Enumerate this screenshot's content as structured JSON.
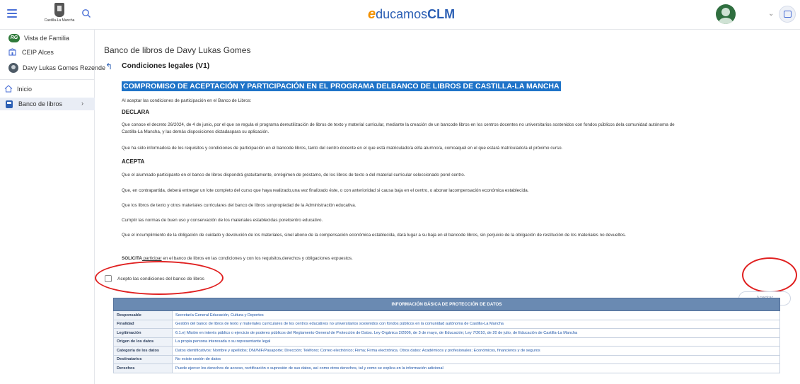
{
  "header": {
    "crest_text": "Castilla-La Mancha",
    "logo": {
      "e": "e",
      "ducamos": "ducamos",
      "clm": "CLM"
    }
  },
  "sidebar": {
    "family_badge": "RG",
    "family_label": "Vista de Familia",
    "school_label": "CEIP Alces",
    "student_label": "Davy Lukas Gomes Rezende",
    "nav": [
      {
        "label": "Inicio"
      },
      {
        "label": "Banco de libros",
        "chevron": "›"
      }
    ]
  },
  "main": {
    "page_title": "Banco de libros de Davy Lukas Gomes",
    "section_title": "Condiciones legales (V1)",
    "doc_heading": "COMPROMISO DE ACEPTACIÓN Y PARTICIPACIÓN EN EL PROGRAMA DELBANCO DE LIBROS DE CASTILLA-LA MANCHA",
    "intro": "Al aceptar las condiciones de participación en el Banco de Libros:",
    "declara_title": "DECLARA",
    "declara_1": "Que conoce el decreto 26/2024, de 4 de junio, por el que se regula el programa dereutilización de libros de texto y material curricular, mediante la creación de un bancode libros en los centros docentes no universitarios sostenidos con fondos públicos dela comunidad autónoma de Castilla-La Mancha, y las demás disposiciones dictadaspara su aplicación.",
    "declara_2": "Que ha sido informado/a de los requisitos y condiciones de participación en el bancode libros, tanto del centro docente en el que está matriculado/a el/la alumno/a, comoaquel en el que estará matriculado/a el próximo curso.",
    "acepta_title": "ACEPTA",
    "acepta_1": "Que el alumnado participante en el banco de libros dispondrá gratuitamente, enrégimen de préstamo, de los libros de texto o del material curricular seleccionado porel centro.",
    "acepta_2": "Que, en contrapartida, deberá entregar un lote completo del curso que haya realizado,una vez finalizado éste, o con anterioridad si causa baja en el centro, o abonar lacompensación económica establecida.",
    "acepta_3": "Que los libros de texto y otros materiales curriculares del banco de libros sonpropiedad de la Administración educativa.",
    "acepta_4": "Cumplir las normas de buen uso y conservación de los materiales establecidas porelcentro educativo.",
    "acepta_5": "Que el incumplimiento de la obligación de cuidado y devolución de los materiales, sinel abono de la compensación económica establecida, dará lugar a su baja en el bancode libros, sin perjuicio de la obligación de restitución de los materiales no devueltos.",
    "solicita_bold": "SOLICITA",
    "solicita_underlined": " participar",
    "solicita_rest": " en el banco de libros en las condiciones y con los requisitos,derechos y obligaciones expuestos.",
    "accept_checkbox_label": "Acepto las condiciones del banco de libros",
    "accept_checked": false,
    "accept_button": "Aceptar"
  },
  "data_protection": {
    "title": "INFORMACIÓN BÁSICA DE PROTECCIÓN DE DATOS",
    "rows": [
      {
        "k": "Responsable",
        "v": "Secretaría General Educación, Cultura y Deportes"
      },
      {
        "k": "Finalidad",
        "v": "Gestión del banco de libros de texto y materiales curriculares de los centros educativos no universitarios sostenidos con fondos públicos en la comunidad autónoma de Castilla-La Mancha"
      },
      {
        "k": "Legitimación",
        "v": "6.1.e) Misión en interés público o ejercicio de poderes públicos del Reglamento General de Protección de Datos. Ley Orgánica 2/2006, de 3 de mayo, de Educación; Ley 7/2010, de 20 de julio, de Educación de Castilla-La Mancha"
      },
      {
        "k": "Origen de los datos",
        "v": "La propia persona interesada o su representante legal"
      },
      {
        "k": "Categoría de los datos",
        "v": "Datos identificativos: Nombre y apellidos; DNI/NIF/Pasaporte; Dirección; Teléfono; Correo electrónico; Firma; Firma electrónica. Otros datos: Académicos y profesionales; Económicos, financieros y de seguros"
      },
      {
        "k": "Destinatarios",
        "v": "No existe cesión de datos"
      },
      {
        "k": "Derechos",
        "v": "Puede ejercer los derechos de acceso, rectificación o supresión de sus datos, así como otros derechos, tal y como se explica en la información adicional"
      }
    ]
  }
}
